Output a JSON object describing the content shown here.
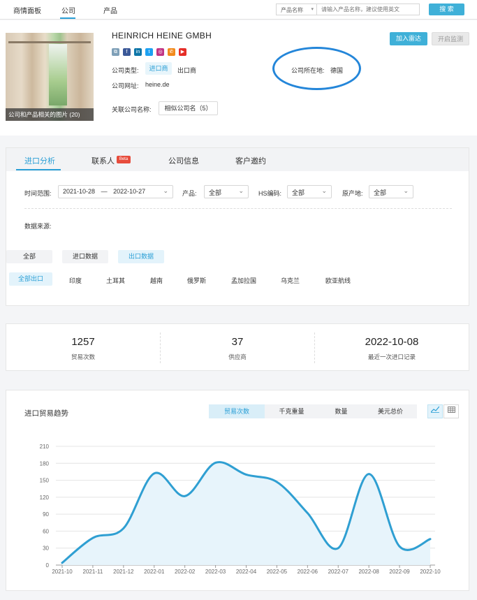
{
  "nav": {
    "items": [
      "商情面板",
      "公司",
      "产品"
    ],
    "search_select": "产品名称",
    "search_placeholder": "请输入产品名称，建议使用英文",
    "search_button": "搜 索"
  },
  "company": {
    "image_caption": "公司和产品相关的图片 (20)",
    "name": "HEINRICH HEINE GMBH",
    "social_icons": [
      "link-icon",
      "facebook-icon",
      "linkedin-icon",
      "twitter-icon",
      "instagram-icon",
      "phone-icon",
      "youtube-icon"
    ],
    "type_label": "公司类型:",
    "type_import": "进口商",
    "type_export": "出口商",
    "website_label": "公司网址:",
    "website": "heine.de",
    "location_label": "公司所在地:",
    "location": "德国",
    "related_label": "关联公司名称:",
    "related_button": "相似公司名（5）",
    "add_radar": "加入雷达",
    "monitor": "开启监测"
  },
  "analysis": {
    "tabs": [
      "进口分析",
      "联系人",
      "公司信息",
      "客户邀约"
    ],
    "beta": "Beta",
    "time_label": "时间范围:",
    "date_from": "2021-10-28",
    "date_sep": "—",
    "date_to": "2022-10-27",
    "product_label": "产品:",
    "product_value": "全部",
    "hs_label": "HS编码:",
    "hs_value": "全部",
    "origin_label": "原产地:",
    "origin_value": "全部",
    "source_label": "数据来源:",
    "source_pills": [
      "全部",
      "进口数据",
      "出口数据"
    ],
    "countries": [
      "全部出口",
      "印度",
      "土耳其",
      "越南",
      "俄罗斯",
      "孟加拉国",
      "乌克兰",
      "欧亚航线"
    ]
  },
  "stats": [
    {
      "value": "1257",
      "caption": "贸易次数"
    },
    {
      "value": "37",
      "caption": "供应商"
    },
    {
      "value": "2022-10-08",
      "caption": "最近一次进口记录"
    }
  ],
  "chart_panel": {
    "title": "进口贸易趋势",
    "segments": [
      "贸易次数",
      "千克重量",
      "数量",
      "美元总价"
    ],
    "views": [
      "line-chart-icon",
      "table-icon"
    ]
  },
  "chart_data": {
    "type": "area",
    "categories": [
      "2021-10",
      "2021-11",
      "2021-12",
      "2022-01",
      "2022-02",
      "2022-03",
      "2022-04",
      "2022-05",
      "2022-06",
      "2022-07",
      "2022-08",
      "2022-09",
      "2022-10"
    ],
    "values": [
      4,
      48,
      65,
      162,
      122,
      181,
      160,
      147,
      92,
      30,
      161,
      33,
      46
    ],
    "ylim": [
      0,
      210
    ],
    "yticks": [
      0,
      30,
      60,
      90,
      120,
      150,
      180,
      210
    ],
    "grid": true,
    "line_color": "#2f9fd2",
    "fill_color": "#e7f4fb"
  }
}
